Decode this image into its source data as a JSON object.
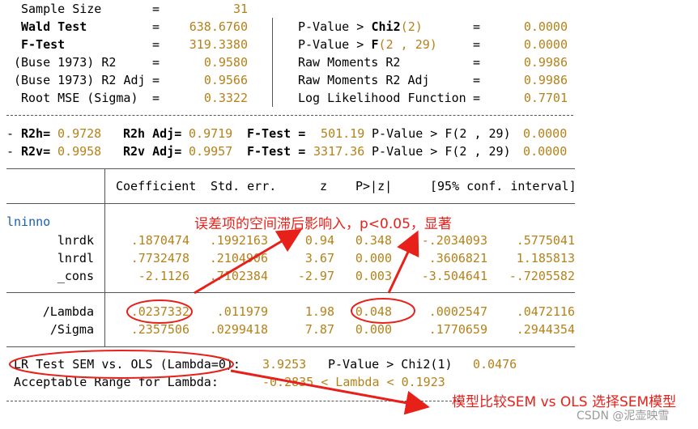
{
  "stats_left": [
    {
      "label": "Sample Size",
      "eq": "=",
      "value": "31"
    },
    {
      "label": "Wald Test",
      "eq": "=",
      "value": "638.6760"
    },
    {
      "label": "F-Test",
      "eq": "=",
      "value": "319.3380"
    },
    {
      "label": "(Buse 1973) R2",
      "eq": "=",
      "value": "0.9580"
    },
    {
      "label": "(Buse 1973) R2 Adj",
      "eq": "=",
      "value": "0.9566"
    },
    {
      "label": "Root MSE (Sigma)",
      "eq": "=",
      "value": "0.3322"
    }
  ],
  "stats_right": [
    {
      "label_a": "P-Value > ",
      "label_b": "Chi2",
      "label_c": "(2)",
      "eq": "=",
      "value": "0.0000"
    },
    {
      "label_a": "P-Value > ",
      "label_b": "F",
      "label_c": "(2 , 29)",
      "eq": "=",
      "value": "0.0000"
    },
    {
      "label_a": "Raw Moments R2",
      "label_b": "",
      "label_c": "",
      "eq": "=",
      "value": "0.9986"
    },
    {
      "label_a": "Raw Moments R2 Adj",
      "label_b": "",
      "label_c": "",
      "eq": "=",
      "value": "0.9986"
    },
    {
      "label_a": "Log Likelihood Function",
      "label_b": "",
      "label_c": "",
      "eq": "=",
      "value": "0.7701"
    }
  ],
  "r2_lines": [
    {
      "prefix": "- ",
      "r2": "R2h=",
      "r2v": " 0.9728",
      "adj": "R2h Adj=",
      "adjv": " 0.9719",
      "f": "F-Test =",
      "fv": "  501.19",
      "pv": " P-Value > F(2 , 29)",
      "pvv": "  0.0000"
    },
    {
      "prefix": "- ",
      "r2": "R2v=",
      "r2v": " 0.9958",
      "adj": "R2v Adj=",
      "adjv": " 0.9957",
      "f": "F-Test =",
      "fv": " 3317.36",
      "pv": " P-Value > F(2 , 29)",
      "pvv": "  0.0000"
    }
  ],
  "table_header": [
    "Coefficient",
    "Std. err.",
    "z",
    "P>|z|",
    "[95% conf. interval]"
  ],
  "group_label": "lninno",
  "rows_main": [
    {
      "name": "lnrdk",
      "coef": ".1870474",
      "se": ".1992163",
      "z": "0.94",
      "p": "0.348",
      "lo": "-.2034093",
      "hi": ".5775041"
    },
    {
      "name": "lnrdl",
      "coef": ".7732478",
      "se": ".2104906",
      "z": "3.67",
      "p": "0.000",
      "lo": ".3606821",
      "hi": "1.185813"
    },
    {
      "name": "_cons",
      "coef": "-2.1126",
      "se": ".7102384",
      "z": "-2.97",
      "p": "0.003",
      "lo": "-3.504641",
      "hi": "-.7205582"
    }
  ],
  "rows_extra": [
    {
      "name": "/Lambda",
      "coef": ".0237332",
      "se": ".011979",
      "z": "1.98",
      "p": "0.048",
      "lo": ".0002547",
      "hi": ".0472116"
    },
    {
      "name": "/Sigma",
      "coef": ".2357506",
      "se": ".0299418",
      "z": "7.87",
      "p": "0.000",
      "lo": ".1770659",
      "hi": ".2944354"
    }
  ],
  "lr_test": {
    "label": "LR Test SEM vs. OLS (Lambda=0):",
    "value": "3.9253",
    "p_label": "P-Value > Chi2(1)",
    "p_value": "0.0476"
  },
  "range": {
    "label": "Acceptable Range for Lambda:",
    "value": "-0.2835 < Lambda < 0.1923"
  },
  "annotations": {
    "top": "误差项的空间滞后影响入，p<0.05，显著",
    "bottom": "模型比较SEM vs OLS 选择SEM模型"
  },
  "watermark": "CSDN @泥壶映雪",
  "colors": {
    "annotation": "#e8201a",
    "numbers": "#b5821a"
  }
}
